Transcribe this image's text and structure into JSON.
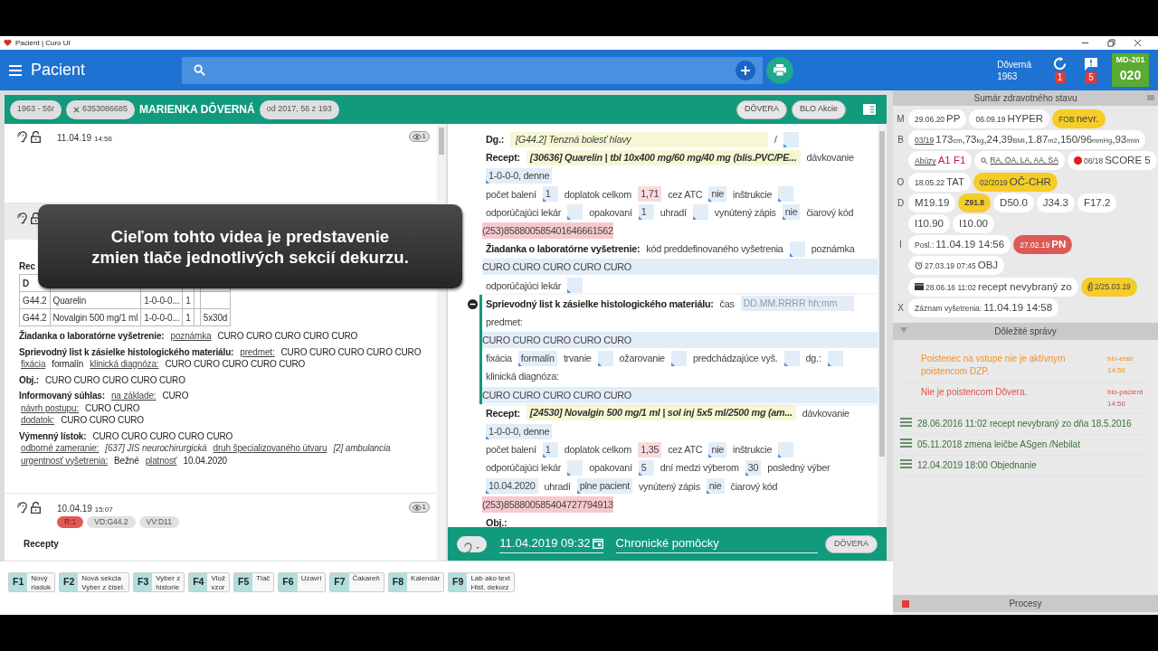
{
  "window": {
    "title": "Pacient | Curo UI"
  },
  "appbar": {
    "title": "Pacient",
    "patient_name": "Dôverná",
    "patient_year": "1963",
    "sync_count": "1",
    "message_count": "5",
    "user_code": "MD-201",
    "user_number": "020"
  },
  "patient_header": {
    "chips": [
      {
        "text": "1963 - 56r",
        "kind": "plain"
      },
      {
        "text": "6353086685",
        "kind": "removable"
      }
    ],
    "name": "MARIENKA DÔVERNÁ",
    "coverage": "od 2017, 56 z 193",
    "buttons": [
      "DÔVERA",
      "BLO Akcie"
    ]
  },
  "history": [
    {
      "kind": "entry",
      "date": "11.04.19",
      "time": "14:56",
      "views": "1"
    },
    {
      "kind": "covered",
      "recipe_heading": "Rec",
      "table": {
        "columns": [
          "D"
        ],
        "rows": [
          [
            "G44.2",
            "Quarelin",
            "1-0-0-0...",
            "1",
            "",
            ""
          ],
          [
            "G44.2",
            "Novalgin 500 mg/1 ml",
            "1-0-0-0...",
            "1",
            "",
            "5x30d"
          ]
        ]
      },
      "blocks": [
        [
          [
            {
              "kind": "label",
              "text": "Žiadanka o laboratórne vyšetrenie:"
            },
            {
              "kind": "link",
              "text": "poznámka"
            },
            {
              "kind": "value",
              "text": "CURO CURO CURO CURO CURO"
            }
          ]
        ],
        [
          [
            {
              "kind": "label",
              "text": "Sprievodný list k zásielke histologického materiálu:"
            },
            {
              "kind": "link",
              "text": "predmet:"
            },
            {
              "kind": "value",
              "text": "CURO CURO CURO CURO CURO"
            }
          ],
          [
            {
              "kind": "link",
              "text": "fixácia"
            },
            {
              "kind": "value",
              "text": "formalín"
            },
            {
              "kind": "link",
              "text": "klinická diagnóza:"
            },
            {
              "kind": "value",
              "text": "CURO CURO CURO CURO CURO"
            }
          ]
        ],
        [
          [
            {
              "kind": "label",
              "text": "Obj.:"
            },
            {
              "kind": "value",
              "text": "CURO CURO CURO CURO CURO"
            }
          ]
        ],
        [
          [
            {
              "kind": "label",
              "text": "Informovaný súhlas:"
            },
            {
              "kind": "link",
              "text": "na základe:"
            },
            {
              "kind": "value",
              "text": "CURO"
            }
          ],
          [
            {
              "kind": "link",
              "text": "návrh postupu:"
            },
            {
              "kind": "value",
              "text": "CURO CURO"
            }
          ],
          [
            {
              "kind": "link",
              "text": "dodatok:"
            },
            {
              "kind": "value",
              "text": "CURO CURO CURO"
            }
          ]
        ],
        [
          [
            {
              "kind": "label",
              "text": "Výmenný lístok:"
            },
            {
              "kind": "value",
              "text": "CURO CURO CURO CURO CURO"
            }
          ],
          [
            {
              "kind": "link",
              "text": "odborné zameranie:"
            },
            {
              "kind": "italic",
              "text": "[637] JIS neurochirurgická"
            },
            {
              "kind": "link",
              "text": "druh špecializovaného útvaru"
            },
            {
              "kind": "italic",
              "text": "[2] ambulancia"
            }
          ],
          [
            {
              "kind": "link",
              "text": "urgentnosť vyšetrenia:"
            },
            {
              "kind": "value",
              "text": "Bežné"
            },
            {
              "kind": "link",
              "text": "platnosť"
            },
            {
              "kind": "value",
              "text": "10.04.2020"
            }
          ]
        ]
      ]
    },
    {
      "kind": "entry",
      "date": "10.04.19",
      "time": "15:07",
      "views": "1",
      "tags": [
        {
          "text": "R:1",
          "kind": "danger"
        },
        {
          "text": "VD:G44.2",
          "kind": "plain"
        },
        {
          "text": "VV:D11",
          "kind": "plain"
        }
      ],
      "section_heading": "Recepty"
    }
  ],
  "overlay": {
    "lines": [
      "Cieľom tohto videa je predstavenie",
      "zmien tlače jednotlivých sekcií dekurzu."
    ]
  },
  "form": {
    "sections": [
      {
        "kind": "plain",
        "lines": [
          [
            {
              "kind": "label",
              "text": "Dg.:"
            },
            {
              "kind": "diagnosis",
              "text": "[G44.2] Tenzná bolesť hlavy"
            },
            {
              "kind": "text",
              "text": "/"
            },
            {
              "kind": "field"
            }
          ],
          [
            {
              "kind": "label",
              "text": "Recept:"
            },
            {
              "kind": "drug",
              "text": "[30636] Quarelin | tbl 10x400 mg/60 mg/40 mg (blis.PVC/PE..."
            },
            {
              "kind": "text",
              "text": "dávkovanie"
            }
          ],
          [
            {
              "kind": "field",
              "text": "1-0-0-0, denne"
            }
          ],
          [
            {
              "kind": "text",
              "text": "počet balení"
            },
            {
              "kind": "field",
              "text": "1"
            },
            {
              "kind": "text",
              "text": "doplatok celkom"
            },
            {
              "kind": "price",
              "text": "1,71"
            },
            {
              "kind": "text",
              "text": "cez ATC"
            },
            {
              "kind": "field",
              "text": "nie"
            },
            {
              "kind": "text",
              "text": "inštrukcie"
            },
            {
              "kind": "field"
            }
          ],
          [
            {
              "kind": "text",
              "text": "odporúčajúci lekár"
            },
            {
              "kind": "field"
            },
            {
              "kind": "text",
              "text": "opakovaní"
            },
            {
              "kind": "field",
              "text": "1"
            },
            {
              "kind": "text",
              "text": "uhradí"
            },
            {
              "kind": "field"
            },
            {
              "kind": "text",
              "text": "vynútený zápis"
            },
            {
              "kind": "field",
              "text": "nie"
            },
            {
              "kind": "text",
              "text": "čiarový kód"
            }
          ],
          [
            {
              "kind": "barcode",
              "text": "(253)858800585401646661562"
            }
          ],
          [
            {
              "kind": "label",
              "text": "Žiadanka o laboratórne vyšetrenie:"
            },
            {
              "kind": "text",
              "text": "kód preddefinovaného vyšetrenia"
            },
            {
              "kind": "field"
            },
            {
              "kind": "text",
              "text": "poznámka"
            }
          ],
          [
            {
              "kind": "fullfield",
              "text": "CURO CURO CURO CURO CURO"
            }
          ],
          [
            {
              "kind": "text",
              "text": "odporúčajúci lekár"
            },
            {
              "kind": "field"
            }
          ]
        ]
      },
      {
        "kind": "active",
        "lines": [
          [
            {
              "kind": "label",
              "text": "Sprievodný list k zásielke histologického materiálu:"
            },
            {
              "kind": "text",
              "text": "čas"
            },
            {
              "kind": "field",
              "placeholder": "DD.MM.RRRR hh:mm"
            }
          ],
          [
            {
              "kind": "text",
              "text": "predmet:"
            }
          ],
          [
            {
              "kind": "fullfield",
              "text": "CURO CURO CURO CURO CURO"
            }
          ],
          [
            {
              "kind": "text",
              "text": "fixácia"
            },
            {
              "kind": "field",
              "text": "formalín"
            },
            {
              "kind": "text",
              "text": "trvanie"
            },
            {
              "kind": "field"
            },
            {
              "kind": "text",
              "text": "ožarovanie"
            },
            {
              "kind": "field"
            },
            {
              "kind": "text",
              "text": "predchádzajúce vyš."
            },
            {
              "kind": "field"
            },
            {
              "kind": "text",
              "text": "dg.:"
            },
            {
              "kind": "field"
            }
          ],
          [
            {
              "kind": "text",
              "text": "klinická diagnóza:"
            }
          ],
          [
            {
              "kind": "fullfield",
              "text": "CURO CURO CURO CURO CURO"
            }
          ]
        ]
      },
      {
        "kind": "plain",
        "lines": [
          [
            {
              "kind": "label",
              "text": "Recept:"
            },
            {
              "kind": "drug",
              "text": "[24530] Novalgin 500 mg/1 ml | sol inj 5x5 ml/2500 mg (am..."
            },
            {
              "kind": "text",
              "text": "dávkovanie"
            }
          ],
          [
            {
              "kind": "field",
              "text": "1-0-0-0, denne"
            }
          ],
          [
            {
              "kind": "text",
              "text": "počet balení"
            },
            {
              "kind": "field",
              "text": "1"
            },
            {
              "kind": "text",
              "text": "doplatok celkom"
            },
            {
              "kind": "price",
              "text": "1,35"
            },
            {
              "kind": "text",
              "text": "cez ATC"
            },
            {
              "kind": "field",
              "text": "nie"
            },
            {
              "kind": "text",
              "text": "inštrukcie"
            },
            {
              "kind": "field"
            }
          ],
          [
            {
              "kind": "text",
              "text": "odporúčajúci lekár"
            },
            {
              "kind": "field"
            },
            {
              "kind": "text",
              "text": "opakovaní"
            },
            {
              "kind": "field",
              "text": "5"
            },
            {
              "kind": "text",
              "text": "dní medzi výberom"
            },
            {
              "kind": "field",
              "text": "30"
            },
            {
              "kind": "text",
              "text": "posledný výber"
            }
          ],
          [
            {
              "kind": "field",
              "text": "10.04.2020"
            },
            {
              "kind": "text",
              "text": "uhradí"
            },
            {
              "kind": "field",
              "text": "plne pacient"
            },
            {
              "kind": "text",
              "text": "vynútený zápis"
            },
            {
              "kind": "field",
              "text": "nie"
            },
            {
              "kind": "text",
              "text": "čiarový kód"
            }
          ],
          [
            {
              "kind": "barcode",
              "text": "(253)858800585404727794913"
            }
          ],
          [
            {
              "kind": "label",
              "text": "Obj.:"
            }
          ]
        ]
      }
    ]
  },
  "form_footer": {
    "datetime": "11.04.2019 09:32",
    "title": "Chronické pomôcky",
    "button": "DÔVERA"
  },
  "summary": {
    "title": "Sumár zdravotného stavu",
    "rows": [
      {
        "letter": "M",
        "chips": [
          {
            "kind": "plain",
            "parts": [
              {
                "kind": "small",
                "text": "29.06.20"
              },
              {
                "kind": "big",
                "text": "PP"
              }
            ]
          },
          {
            "kind": "plain",
            "parts": [
              {
                "kind": "small",
                "text": "06.09.19"
              },
              {
                "kind": "big",
                "text": "HYPER"
              }
            ]
          },
          {
            "kind": "warning",
            "parts": [
              {
                "kind": "small",
                "text": "FOB"
              },
              {
                "kind": "big",
                "text": "nevr."
              }
            ]
          }
        ]
      },
      {
        "letter": "B",
        "chips": [
          {
            "kind": "plain",
            "parts": [
              {
                "kind": "link",
                "text": "03/19"
              },
              {
                "kind": "big",
                "text": "173"
              },
              {
                "kind": "unit",
                "text": "cm"
              },
              {
                "kind": "big",
                "text": ",73"
              },
              {
                "kind": "unit",
                "text": "kg"
              },
              {
                "kind": "big",
                "text": ",24,39"
              },
              {
                "kind": "unit",
                "text": "BMI"
              },
              {
                "kind": "big",
                "text": ",1.87"
              },
              {
                "kind": "unit",
                "text": "m2"
              },
              {
                "kind": "big",
                "text": ",150/96"
              },
              {
                "kind": "unit",
                "text": "mmHg"
              },
              {
                "kind": "big",
                "text": ",93"
              },
              {
                "kind": "unit",
                "text": "/min"
              }
            ]
          }
        ]
      },
      {
        "chips": [
          {
            "kind": "plain",
            "parts": [
              {
                "kind": "link",
                "text": "Abúzy"
              },
              {
                "kind": "alert",
                "text": "A1 F1"
              }
            ]
          },
          {
            "kind": "finding",
            "parts": [
              {
                "kind": "link",
                "text": "RA, OA, LA, AA, SA"
              }
            ]
          },
          {
            "kind": "risk",
            "parts": [
              {
                "kind": "small",
                "text": "06/18"
              },
              {
                "kind": "big",
                "text": "SCORE 5"
              }
            ]
          }
        ]
      },
      {
        "letter": "O",
        "chips": [
          {
            "kind": "plain",
            "parts": [
              {
                "kind": "small",
                "text": "18.05.22"
              },
              {
                "kind": "big",
                "text": "TAT"
              }
            ]
          },
          {
            "kind": "warning",
            "parts": [
              {
                "kind": "small",
                "text": "02/2019"
              },
              {
                "kind": "big",
                "text": "OČ-CHR"
              }
            ]
          }
        ]
      },
      {
        "letter": "D",
        "chips": [
          {
            "kind": "plain",
            "parts": [
              {
                "kind": "big",
                "text": "M19.19"
              }
            ]
          },
          {
            "kind": "warning",
            "parts": [
              {
                "kind": "small",
                "text": "Z91.8"
              }
            ]
          },
          {
            "kind": "plain",
            "parts": [
              {
                "kind": "big",
                "text": "D50.0"
              }
            ]
          },
          {
            "kind": "plain",
            "parts": [
              {
                "kind": "big",
                "text": "J34.3"
              }
            ]
          },
          {
            "kind": "plain",
            "parts": [
              {
                "kind": "big",
                "text": "F17.2"
              }
            ]
          }
        ]
      },
      {
        "chips": [
          {
            "kind": "plain",
            "parts": [
              {
                "kind": "big",
                "text": "I10.90"
              }
            ]
          },
          {
            "kind": "plain",
            "parts": [
              {
                "kind": "big",
                "text": "I10.00"
              }
            ]
          }
        ]
      },
      {
        "letter": "I",
        "chips": [
          {
            "kind": "plain",
            "parts": [
              {
                "kind": "small",
                "text": "Posl.:"
              },
              {
                "kind": "big",
                "text": "11.04.19 14:56"
              }
            ]
          },
          {
            "kind": "danger",
            "parts": [
              {
                "kind": "small",
                "text": "27.02.19"
              },
              {
                "kind": "big",
                "text": "PN"
              }
            ]
          }
        ]
      },
      {
        "chips": [
          {
            "kind": "reminder",
            "parts": [
              {
                "kind": "small",
                "text": "27.03.19 07:45"
              },
              {
                "kind": "big",
                "text": "OBJ"
              }
            ]
          }
        ]
      },
      {
        "chips": [
          {
            "kind": "message",
            "parts": [
              {
                "kind": "small",
                "text": "28.06.16 11:02"
              },
              {
                "kind": "big",
                "text": "recept nevybraný zo"
              }
            ]
          },
          {
            "kind": "attachment",
            "parts": [
              {
                "kind": "small",
                "text": "2/25.03.19"
              }
            ]
          }
        ]
      },
      {
        "letter": "X",
        "chips": [
          {
            "kind": "plain",
            "parts": [
              {
                "kind": "small",
                "text": "Záznam vyšetrenia:"
              },
              {
                "kind": "big",
                "text": "11.04.19 14:58"
              }
            ]
          }
        ]
      }
    ]
  },
  "messages": {
    "title": "Dôležité správy",
    "items": [
      {
        "kind": "warning",
        "text": "Poistenec na vstupe nie je aktívnym poistencom DZP.",
        "source": "blo-elab",
        "time": "14:56"
      },
      {
        "kind": "error",
        "text": "Nie je poistencom Dôvera.",
        "source": "blo-pacient",
        "time": "14:56"
      },
      {
        "kind": "note",
        "text": "28.06.2016 11:02 recept nevybraný zo dňa 18.5.2016"
      },
      {
        "kind": "note",
        "text": "05.11.2018 zmena leičbe ASgen /Nebilat"
      },
      {
        "kind": "note",
        "text": "12.04.2019 18:00 Objednanie"
      }
    ]
  },
  "processes": {
    "title": "Procesy"
  },
  "function_keys": [
    {
      "key": "F1",
      "lines": [
        "Nový",
        "riadok"
      ]
    },
    {
      "key": "F2",
      "lines": [
        "Nová sekcia",
        "Vyber z čísel."
      ]
    },
    {
      "key": "F3",
      "lines": [
        "Vyber z",
        "historie"
      ]
    },
    {
      "key": "F4",
      "lines": [
        "Vlož",
        "vzor"
      ]
    },
    {
      "key": "F5",
      "lines": [
        "Tlač"
      ]
    },
    {
      "key": "F6",
      "lines": [
        "Uzavri"
      ]
    },
    {
      "key": "F7",
      "lines": [
        "Čakareň"
      ]
    },
    {
      "key": "F8",
      "lines": [
        "Kalendár"
      ]
    },
    {
      "key": "F9",
      "lines": [
        "Lab ako text",
        "Hist. dekurz"
      ]
    }
  ]
}
